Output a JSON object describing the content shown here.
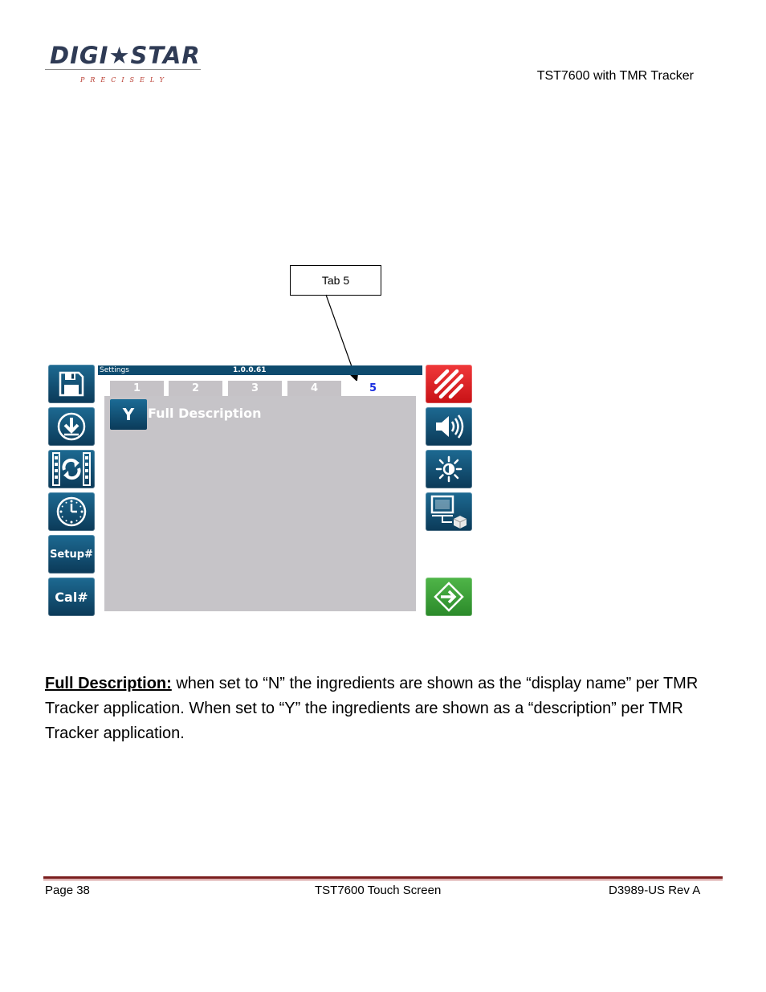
{
  "header": {
    "logo_word": "DIGI★STAR",
    "logo_tagline": "PRECISELY",
    "doc_title": "TST7600 with TMR Tracker"
  },
  "callout": {
    "label": "Tab 5"
  },
  "screen": {
    "title": "Settings",
    "version": "1.0.0.61",
    "tabs": [
      {
        "label": "1"
      },
      {
        "label": "2"
      },
      {
        "label": "3"
      },
      {
        "label": "4"
      },
      {
        "label": "5"
      }
    ],
    "active_tab": "5",
    "setting": {
      "value": "Y",
      "label": "Full Description"
    },
    "left_buttons": [
      {
        "icon": "save-icon"
      },
      {
        "icon": "download-icon"
      },
      {
        "icon": "sync-icon"
      },
      {
        "icon": "clock-icon"
      },
      {
        "icon": "setup-icon",
        "label": "Setup#"
      },
      {
        "icon": "cal-icon",
        "label": "Cal#"
      }
    ],
    "right_buttons": [
      {
        "icon": "zero-icon",
        "color": "#e52326"
      },
      {
        "icon": "speaker-icon"
      },
      {
        "icon": "brightness-icon"
      },
      {
        "icon": "printer-icon"
      },
      {
        "icon": "exit-icon",
        "color": "#3da53a"
      }
    ]
  },
  "body": {
    "term": "Full Description:",
    "text": " when set to “N” the ingredients are shown as the “display name” per TMR Tracker application. When set to “Y” the ingredients are shown as a “description” per TMR Tracker application."
  },
  "footer": {
    "left": "Page 38",
    "center": "TST7600 Touch Screen",
    "right": "D3989-US Rev A"
  },
  "colors": {
    "brand_navy": "#2f3b55",
    "brand_red": "#b83a2e",
    "screen_blue": "#0e4b6e",
    "panel_gray": "#c6c4c8",
    "active_tab_text": "#1a2ee0"
  }
}
